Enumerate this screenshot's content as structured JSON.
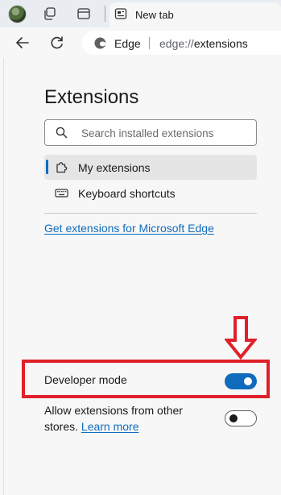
{
  "tab": {
    "title": "New tab"
  },
  "address": {
    "label": "Edge",
    "url_scheme": "edge://",
    "url_path": "extensions"
  },
  "page": {
    "title": "Extensions",
    "search_placeholder": "Search installed extensions",
    "nav": [
      {
        "label": "My extensions",
        "active": true
      },
      {
        "label": "Keyboard shortcuts",
        "active": false
      }
    ],
    "get_extensions_link": "Get extensions for Microsoft Edge",
    "developer_mode": {
      "label": "Developer mode",
      "enabled": true
    },
    "other_stores": {
      "label": "Allow extensions from other stores.",
      "learn_more": "Learn more",
      "enabled": false
    }
  },
  "colors": {
    "accent": "#0f6cbd",
    "annotation": "#e0202a"
  }
}
